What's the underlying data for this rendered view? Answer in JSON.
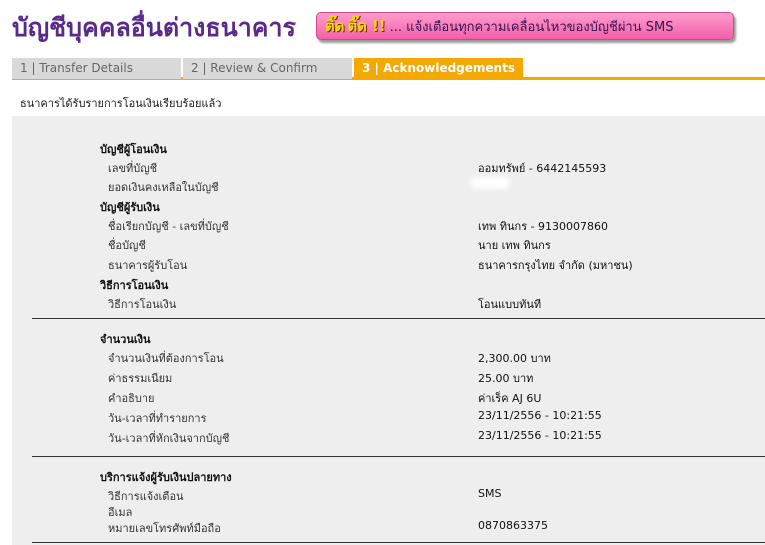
{
  "header": {
    "title": "บัญชีบุคคลอื่นต่างธนาคาร"
  },
  "banner": {
    "tick1": "ติ๊ด",
    "tick2": "ติ๊ด",
    "bang": "!!",
    "message": "... แจ้งเตือนทุกความเคลื่อนไหวของบัญชีผ่าน SMS"
  },
  "tabs": [
    {
      "label": "1 | Transfer Details",
      "active": false
    },
    {
      "label": "2 | Review & Confirm",
      "active": false
    },
    {
      "label": "3 | Acknowledgements",
      "active": true
    }
  ],
  "status": "ธนาคารได้รับรายการโอนเงินเรียบร้อยแล้ว",
  "from_account": {
    "heading": "บัญชีผู้โอนเงิน",
    "account_no_label": "เลขที่บัญชี",
    "account_no_value": "ออมทรัพย์ - 6442145593",
    "balance_label": "ยอดเงินคงเหลือในบัญชี"
  },
  "to_account": {
    "heading": "บัญชีผู้รับเงิน",
    "nickname_label": "ชื่อเรียกบัญชี - เลขที่บัญชี",
    "nickname_value": "เทพ ทินกร - 9130007860",
    "name_label": "ชื่อบัญชี",
    "name_value": "นาย เทพ ทินกร",
    "bank_label": "ธนาคารผู้รับโอน",
    "bank_value": "ธนาคารกรุงไทย จำกัด (มหาชน)"
  },
  "method": {
    "heading": "วิธีการโอนเงิน",
    "label": "วิธีการโอนเงิน",
    "value": "โอนแบบทันที"
  },
  "amount": {
    "heading": "จำนวนเงิน",
    "amount_label": "จำนวนเงินที่ต้องการโอน",
    "amount_value": "2,300.00 บาท",
    "fee_label": "ค่าธรรมเนียม",
    "fee_value": "25.00 บาท",
    "memo_label": "คำอธิบาย",
    "memo_value": "ค่าเร็ค AJ 6U",
    "txn_time_label": "วัน-เวลาที่ทำรายการ",
    "txn_time_value": "23/11/2556 - 10:21:55",
    "debit_time_label": "วัน-เวลาที่หักเงินจากบัญชี",
    "debit_time_value": "23/11/2556 - 10:21:55"
  },
  "notify": {
    "heading": "บริการแจ้งผู้รับเงินปลายทาง",
    "method_label": "วิธีการแจ้งเตือน",
    "method_value": "SMS",
    "email_label": "อีเมล",
    "phone_label": "หมายเลขโทรศัพท์มือถือ",
    "phone_value": "0870863375"
  },
  "colors": {
    "title": "#5a2a8a",
    "tab_active": "#f5a800",
    "tab_inactive": "#d9d9d9",
    "banner": "#f25fa8",
    "panel": "#eeeeee"
  }
}
